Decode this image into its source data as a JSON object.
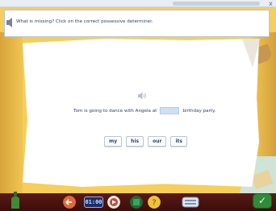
{
  "header": {
    "close_glyph": "x"
  },
  "instruction": {
    "text": "What is missing? Click on the correct possessive determiner.",
    "icon": "speaker-icon"
  },
  "exercise": {
    "sentence_before": "Tom is going to dance with Angela at",
    "sentence_after": "birthday party.",
    "choices": [
      "my",
      "his",
      "our",
      "its"
    ]
  },
  "toolbar": {
    "timer": "01:00",
    "confirm_glyph": "✓"
  },
  "colors": {
    "background": "#f5cf59",
    "text": "#2d3e6a",
    "blank": "#cfe0f5",
    "confirm": "#2f8a3a"
  }
}
